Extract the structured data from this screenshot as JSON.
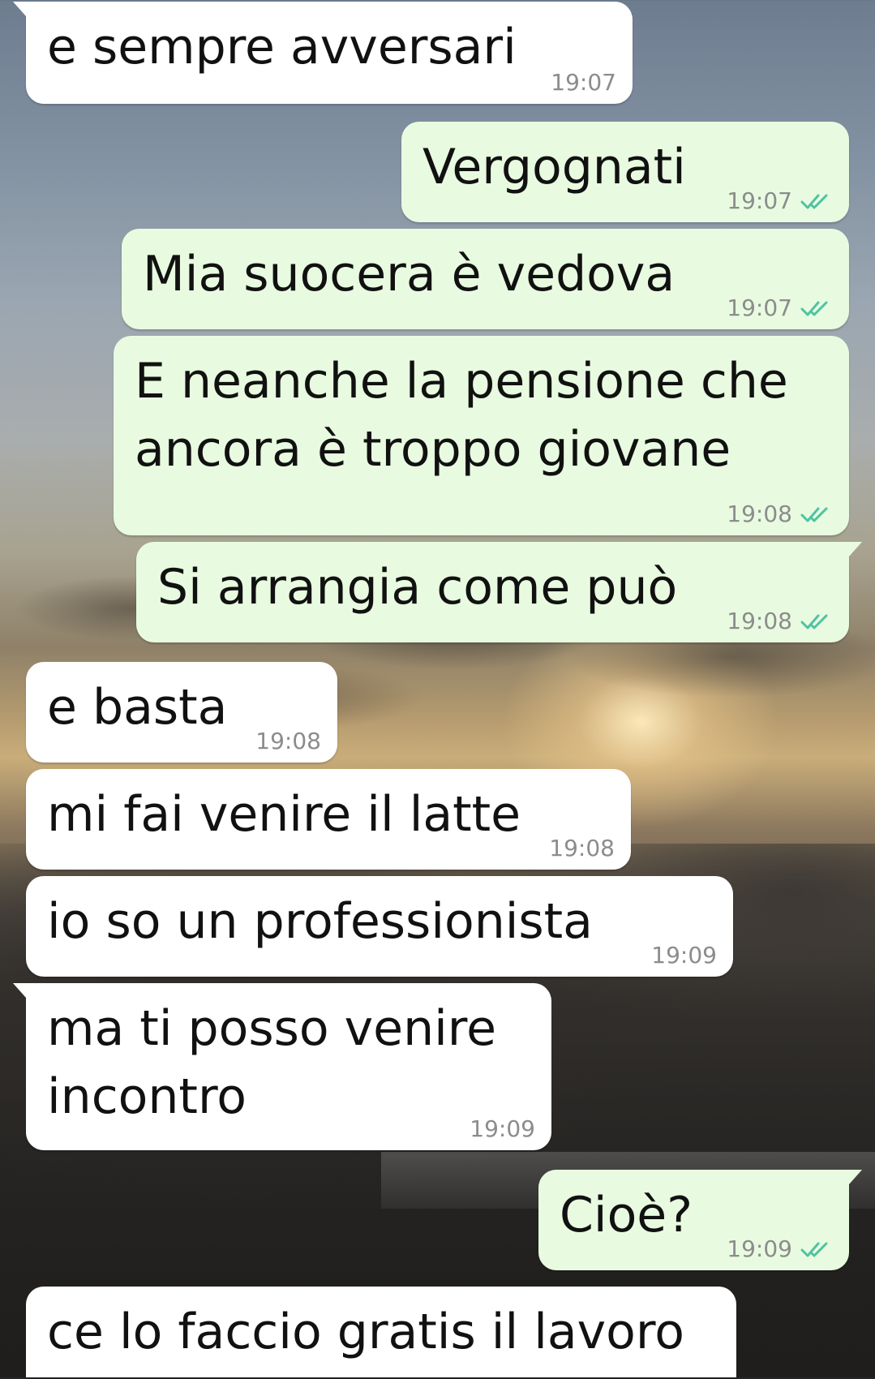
{
  "messages": [
    {
      "direction": "in",
      "text": "e sempre avversari",
      "time": "19:07"
    },
    {
      "direction": "out",
      "text": "Vergognati",
      "time": "19:07",
      "read": true
    },
    {
      "direction": "out",
      "text": "Mia suocera è vedova",
      "time": "19:07",
      "read": true
    },
    {
      "direction": "out",
      "text": "E neanche la pensione che\nancora è troppo giovane",
      "time": "19:08",
      "read": true
    },
    {
      "direction": "out",
      "text": "Si arrangia come può",
      "time": "19:08",
      "read": true
    },
    {
      "direction": "in",
      "text": "e basta",
      "time": "19:08"
    },
    {
      "direction": "in",
      "text": "mi fai venire il latte",
      "time": "19:08"
    },
    {
      "direction": "in",
      "text": "io so un professionista",
      "time": "19:09"
    },
    {
      "direction": "in",
      "text": "ma ti posso venire\nincontro",
      "time": "19:09"
    },
    {
      "direction": "out",
      "text": "Cioè?",
      "time": "19:09",
      "read": true
    },
    {
      "direction": "in",
      "text": "ce lo faccio gratis il lavoro",
      "time": ""
    }
  ],
  "colors": {
    "incoming_bubble": "#ffffff",
    "outgoing_bubble": "#e8fbe0",
    "read_ticks": "#4fc3a1",
    "timestamp": "#8c8c8c"
  },
  "icons": {
    "read_receipt": "double-check-icon"
  }
}
